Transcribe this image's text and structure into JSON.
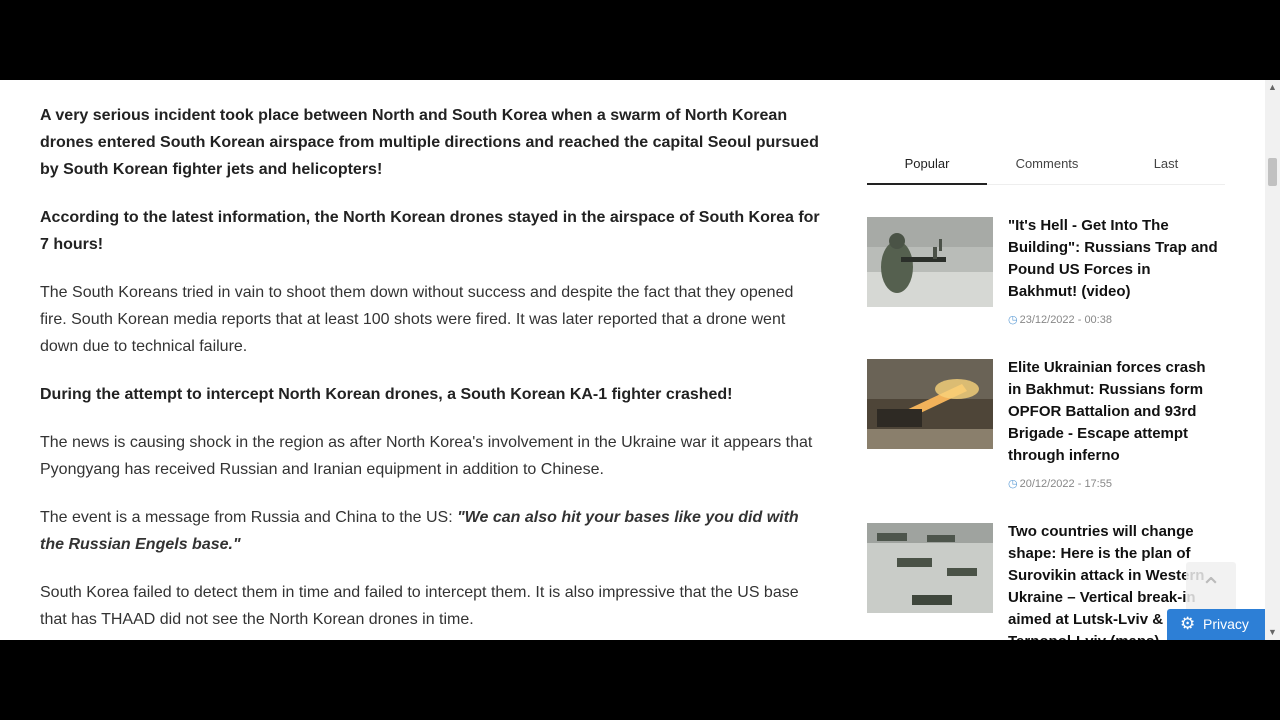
{
  "article": {
    "p1": "A very serious incident took place between North and South Korea when a swarm of North Korean drones entered South Korean airspace from multiple directions and reached the capital Seoul pursued by South Korean fighter jets and helicopters!",
    "p2": "According to the latest information, the North Korean drones stayed in the airspace of South Korea for 7 hours!",
    "p3": "The South Koreans tried in vain to shoot them down without success and despite the fact that they opened fire. South Korean media reports that at least 100 shots were fired. It was later reported that a drone went down due to technical failure.",
    "p4": "During the attempt to intercept North Korean drones, a South Korean KA-1 fighter crashed!",
    "p5": "The news is causing shock in the region as after North Korea's involvement in the Ukraine war it appears that Pyongyang has received Russian and Iranian equipment in addition to Chinese.",
    "p6_prefix": "The event is a message from Russia and China to the US: ",
    "p6_quote": "\"We can also hit your bases like you did with the Russian Engels base.\"",
    "p7": "South Korea failed to detect them in time and failed to intercept them. It is also impressive that the US base that has THAAD did not see the North Korean drones in time."
  },
  "sidebar": {
    "tabs": [
      "Popular",
      "Comments",
      "Last"
    ],
    "posts": [
      {
        "title": "\"It's Hell - Get Into The Building\": Russians Trap and Pound US Forces in Bakhmut! (video)",
        "date": "23/12/2022 - 00:38"
      },
      {
        "title": "Elite Ukrainian forces crash in Bakhmut: Russians form OPFOR Battalion and 93rd Brigade - Escape attempt through inferno",
        "date": "20/12/2022 - 17:55"
      },
      {
        "title": "Two countries will change shape: Here is the plan of Surovikin attack in Western Ukraine – Vertical break-in aimed at Lutsk-Lviv & Ternopol-Lviv (maps)",
        "date": ""
      }
    ]
  },
  "privacy": {
    "label": "Privacy",
    "icon": "gear-icon"
  },
  "colors": {
    "accent": "#2d7fd6",
    "text": "#222222"
  }
}
